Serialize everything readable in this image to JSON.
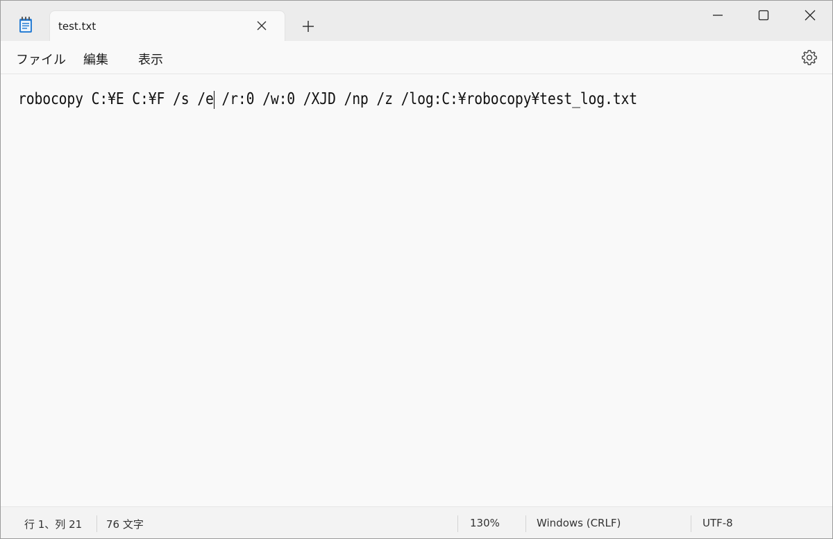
{
  "tab": {
    "title": "test.txt"
  },
  "menu": {
    "file": "ファイル",
    "edit": "編集",
    "view": "表示"
  },
  "editor": {
    "content": "robocopy C:¥E C:¥F /s /e /r:0 /w:0 /XJD /np /z /log:C:¥robocopy¥test_log.txt"
  },
  "status": {
    "position": "行 1、列 21",
    "char_count": "76 文字",
    "zoom": "130%",
    "line_ending": "Windows (CRLF)",
    "encoding": "UTF-8"
  },
  "icons": {
    "app": "notepad-icon",
    "tab_close": "close-icon",
    "new_tab": "plus-icon",
    "minimize": "minimize-icon",
    "maximize": "maximize-icon",
    "close": "close-icon",
    "settings": "gear-icon"
  },
  "colors": {
    "accent": "#1e6fd9",
    "window_bg": "#f9f9f9",
    "titlebar_bg": "#ececec"
  }
}
